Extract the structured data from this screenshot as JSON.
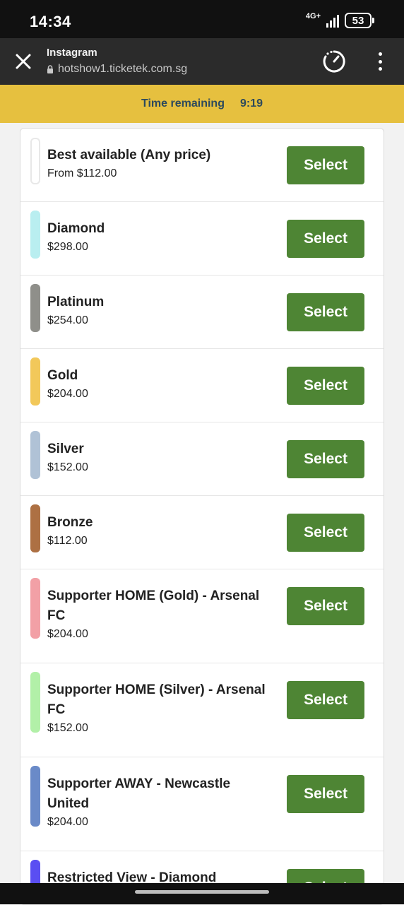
{
  "status_bar": {
    "time": "14:34",
    "network": "4G+",
    "battery": "53"
  },
  "browser": {
    "app_name": "Instagram",
    "url": "hotshow1.ticketek.com.sg",
    "close_icon": "close-icon",
    "timer_icon": "timer-icon",
    "menu_icon": "more-vert-icon"
  },
  "timer": {
    "label": "Time remaining",
    "value": "9:19",
    "bg_color": "#e6c03f"
  },
  "tickets": [
    {
      "name": "Best available (Any price)",
      "price": "From $112.00",
      "color": "#ffffff",
      "select_label": "Select"
    },
    {
      "name": "Diamond",
      "price": "$298.00",
      "color": "#b9eef0",
      "select_label": "Select"
    },
    {
      "name": "Platinum",
      "price": "$254.00",
      "color": "#8f8f8a",
      "select_label": "Select"
    },
    {
      "name": "Gold",
      "price": "$204.00",
      "color": "#f2c85a",
      "select_label": "Select"
    },
    {
      "name": "Silver",
      "price": "$152.00",
      "color": "#b0c2d6",
      "select_label": "Select"
    },
    {
      "name": "Bronze",
      "price": "$112.00",
      "color": "#ad7043",
      "select_label": "Select"
    },
    {
      "name": "Supporter HOME (Gold) - Arsenal FC",
      "price": "$204.00",
      "color": "#f2a0a6",
      "select_label": "Select"
    },
    {
      "name": "Supporter HOME (Silver) - Arsenal FC",
      "price": "$152.00",
      "color": "#b2f0a8",
      "select_label": "Select"
    },
    {
      "name": "Supporter AWAY - Newcastle United",
      "price": "$204.00",
      "color": "#6a8ac8",
      "select_label": "Select"
    },
    {
      "name": "Restricted View - Diamond",
      "price": "",
      "color": "#5a4ef2",
      "select_label": "Select"
    }
  ],
  "button_color": "#4e8534"
}
